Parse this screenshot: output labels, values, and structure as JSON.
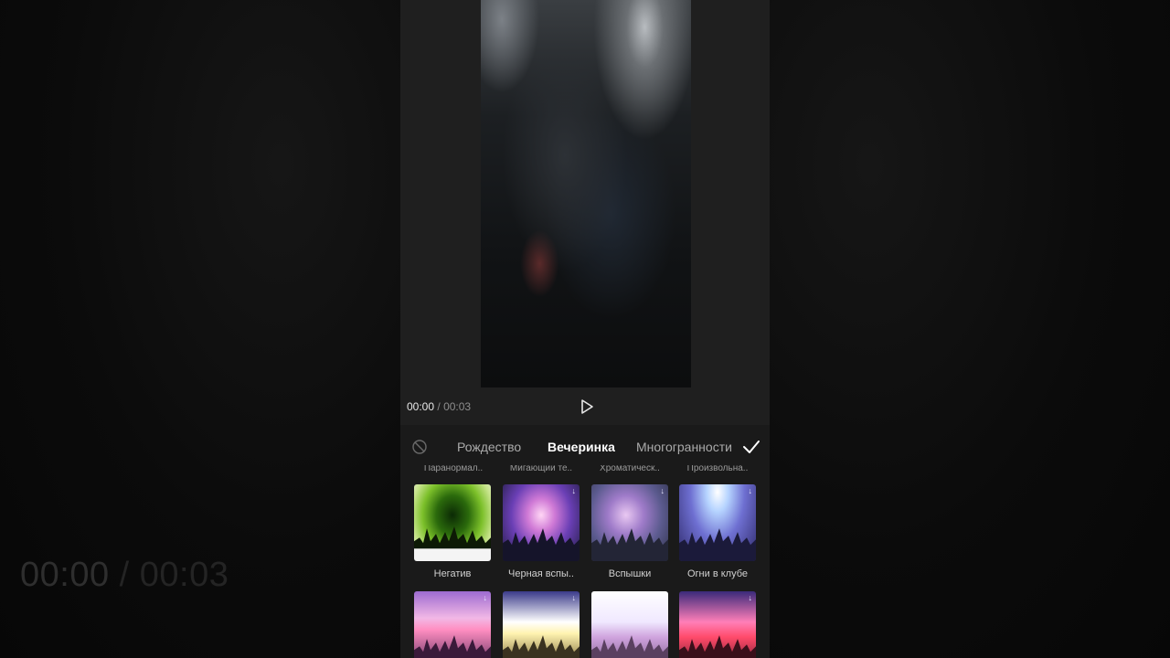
{
  "background": {
    "time_current": "00:00",
    "time_separator": "/",
    "time_total": "00:03"
  },
  "player": {
    "time_current": "00:00",
    "time_separator": "/",
    "time_total": "00:03",
    "play_icon": "play-icon"
  },
  "tabs": {
    "none_icon": "no-effect-icon",
    "items": [
      {
        "label": "Рождество",
        "active": false
      },
      {
        "label": "Вечеринка",
        "active": true
      },
      {
        "label": "Многогранности",
        "active": false
      }
    ],
    "confirm_icon": "check-icon"
  },
  "cut_labels": [
    "Паранормал..",
    "Мигающий те..",
    "Хроматическ..",
    "Произвольна.."
  ],
  "effects_row1": [
    {
      "label": "Негатив",
      "download": false
    },
    {
      "label": "Черная вспы..",
      "download": true
    },
    {
      "label": "Вспышки",
      "download": true
    },
    {
      "label": "Огни в клубе",
      "download": true
    }
  ],
  "effects_row2": [
    {
      "download": true
    },
    {
      "download": true
    },
    {
      "download": false
    },
    {
      "download": true
    }
  ],
  "colors": {
    "panel_bg": "#1a1a1a",
    "active_tab": "#ffffff",
    "inactive_tab": "#aaaaaa"
  }
}
